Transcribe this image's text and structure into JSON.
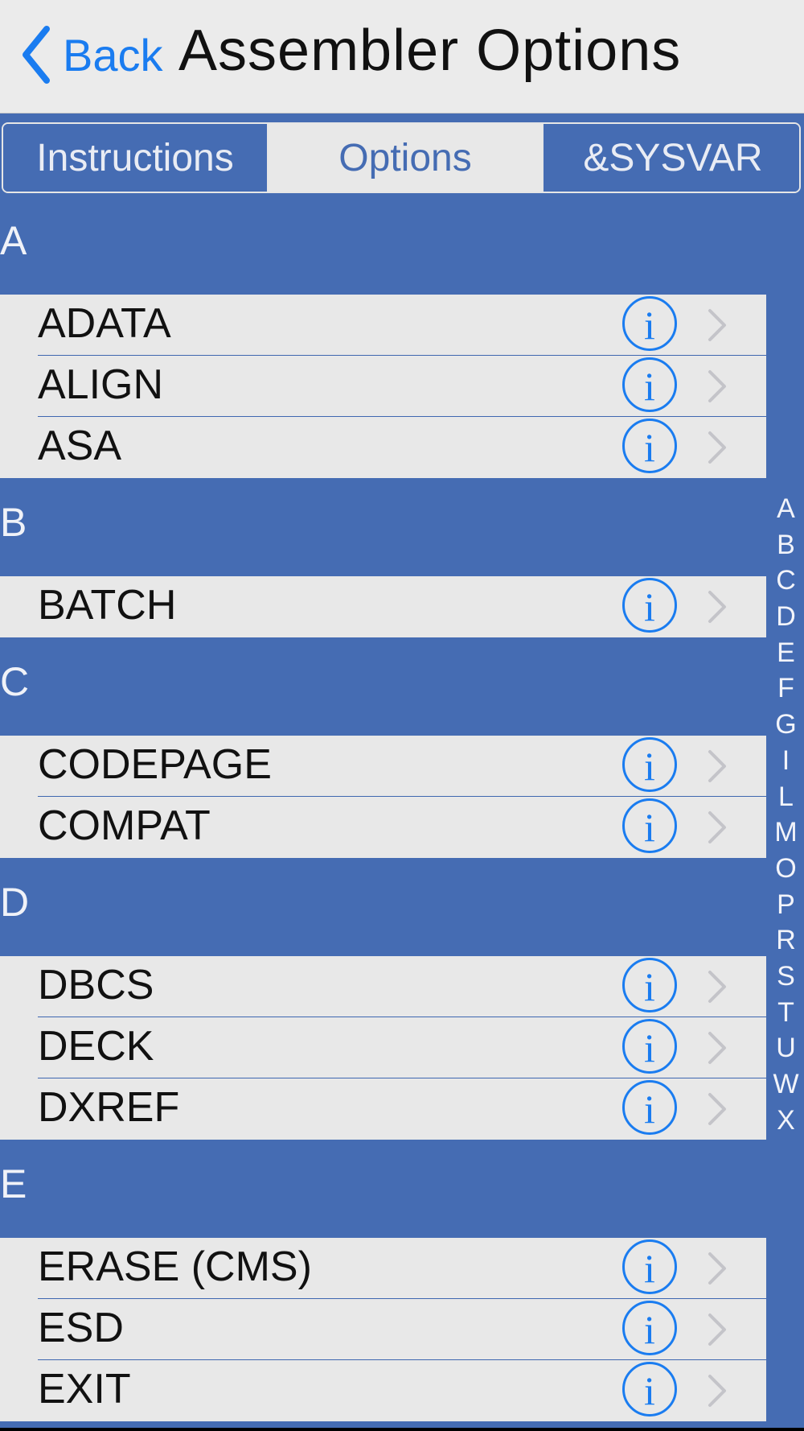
{
  "nav": {
    "back_label": "Back",
    "title": "Assembler Options"
  },
  "tabs": [
    {
      "label": "Instructions",
      "active": false
    },
    {
      "label": "Options",
      "active": true
    },
    {
      "label": "&SYSVAR",
      "active": false
    }
  ],
  "sections": [
    {
      "letter": "A",
      "items": [
        "ADATA",
        "ALIGN",
        "ASA"
      ]
    },
    {
      "letter": "B",
      "items": [
        "BATCH"
      ]
    },
    {
      "letter": "C",
      "items": [
        "CODEPAGE",
        "COMPAT"
      ]
    },
    {
      "letter": "D",
      "items": [
        "DBCS",
        "DECK",
        "DXREF"
      ]
    },
    {
      "letter": "E",
      "items": [
        "ERASE (CMS)",
        "ESD",
        "EXIT"
      ]
    }
  ],
  "row_info_glyph": "i",
  "index": [
    "A",
    "B",
    "C",
    "D",
    "E",
    "F",
    "G",
    "I",
    "L",
    "M",
    "O",
    "P",
    "R",
    "S",
    "T",
    "U",
    "W",
    "X"
  ],
  "icons": {
    "back": "chevron-left-icon",
    "info": "info-circle-icon",
    "disclosure": "chevron-right-icon"
  },
  "colors": {
    "accent": "#1A7CF0",
    "theme_blue": "#456CB3",
    "row_background": "#E8E8E8",
    "navbar_background": "#EBEBEB"
  }
}
